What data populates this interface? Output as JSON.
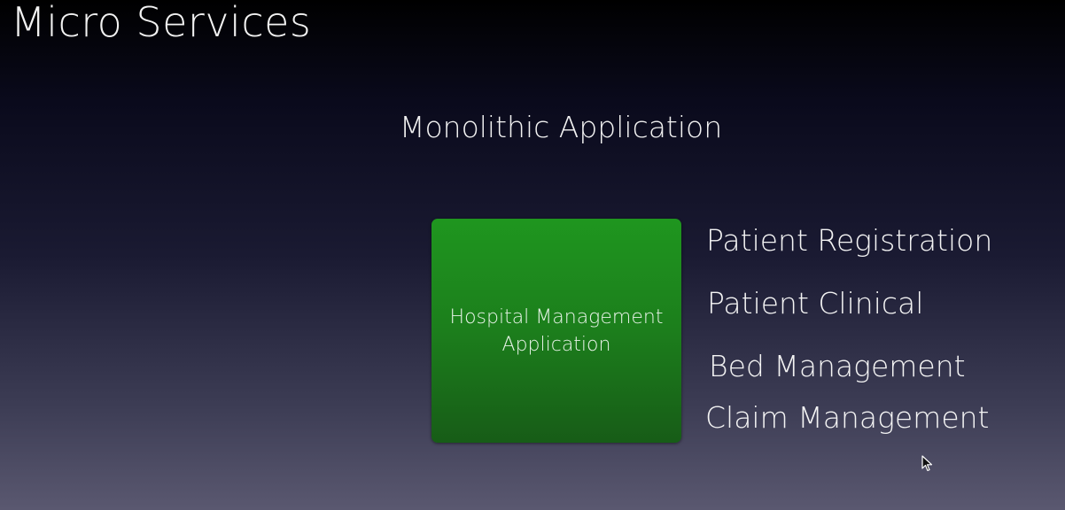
{
  "slide": {
    "title": "Micro Services",
    "subtitle": "Monolithic Application"
  },
  "app_box": {
    "label": "Hospital Management\nApplication",
    "color": "#1c7e1c"
  },
  "modules": [
    {
      "label": "Patient Registration"
    },
    {
      "label": "Patient Clinical"
    },
    {
      "label": "Bed Management"
    },
    {
      "label": "Claim Management"
    }
  ],
  "cursor": {
    "icon": "mouse-pointer-icon"
  }
}
